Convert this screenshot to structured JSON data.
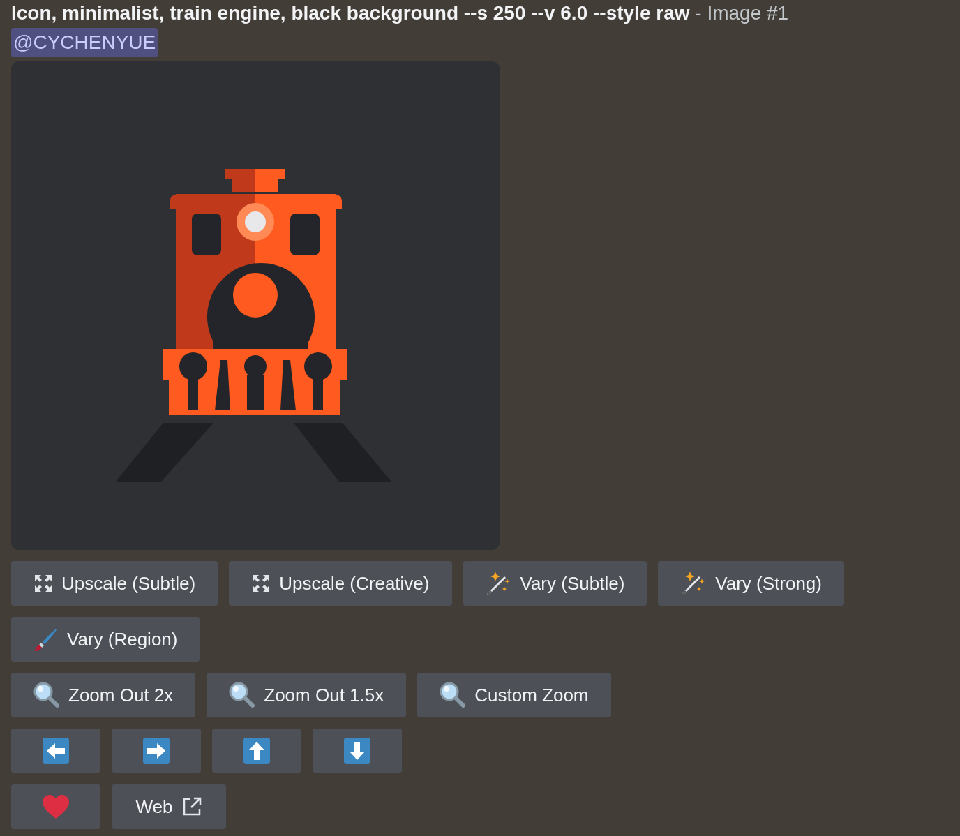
{
  "message": {
    "prompt": "Icon, minimalist, train engine, black background --s 250 --v 6.0 --style raw",
    "suffix": "- Image #1",
    "mention": "@CYCHENYUE"
  },
  "button_rows": [
    [
      {
        "kind": "upscale",
        "label": "Upscale (Subtle)"
      },
      {
        "kind": "upscale",
        "label": "Upscale (Creative)"
      },
      {
        "kind": "wand",
        "label": "Vary (Subtle)"
      },
      {
        "kind": "wand",
        "label": "Vary (Strong)"
      }
    ],
    [
      {
        "kind": "brush",
        "label": "Vary (Region)"
      }
    ],
    [
      {
        "kind": "zoom",
        "label": "Zoom Out 2x"
      },
      {
        "kind": "zoom",
        "label": "Zoom Out 1.5x"
      },
      {
        "kind": "zoom",
        "label": "Custom Zoom"
      }
    ],
    [
      {
        "kind": "left"
      },
      {
        "kind": "right"
      },
      {
        "kind": "up"
      },
      {
        "kind": "down"
      }
    ],
    [
      {
        "kind": "heart"
      },
      {
        "kind": "web",
        "label": "Web"
      }
    ]
  ]
}
